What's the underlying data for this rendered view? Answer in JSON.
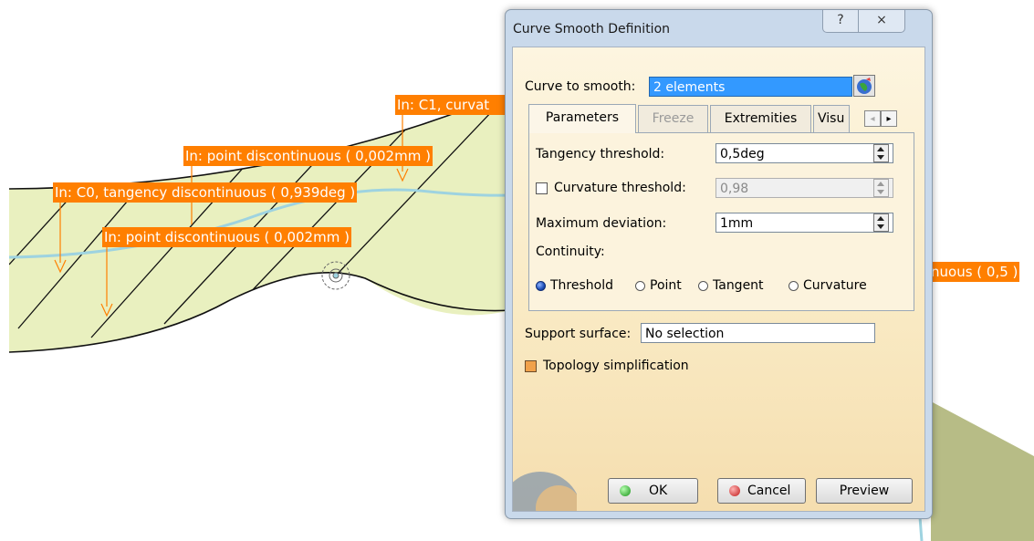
{
  "viewport": {
    "annotations": [
      "In: C1, curvat",
      "In: point discontinuous ( 0,002mm )",
      "In: C0, tangency discontinuous ( 0,939deg )",
      "In: point discontinuous ( 0,002mm )",
      "nuous ( 0,5 )"
    ],
    "colors": {
      "surface": "#e9f0bf",
      "annotation": "#ff7f00",
      "curve": "#9ed3e0"
    }
  },
  "dialog": {
    "title": "Curve Smooth Definition",
    "help_icon": "?",
    "close_icon": "×",
    "curve_to_smooth": {
      "label": "Curve to smooth:",
      "value": "2 elements"
    },
    "tabs": [
      {
        "label": "Parameters",
        "active": true
      },
      {
        "label": "Freeze",
        "disabled": true
      },
      {
        "label": "Extremities"
      },
      {
        "label": "Visu"
      }
    ],
    "tab_arrows": {
      "left": "◂",
      "right": "▸"
    },
    "parameters": {
      "tangency": {
        "label": "Tangency threshold:",
        "value": "0,5deg"
      },
      "curvature": {
        "label": "Curvature threshold:",
        "value": "0,98",
        "checked": false
      },
      "deviation": {
        "label": "Maximum deviation:",
        "value": "1mm"
      },
      "continuity": {
        "label": "Continuity:",
        "options": [
          "Threshold",
          "Point",
          "Tangent",
          "Curvature"
        ],
        "selected": "Threshold"
      }
    },
    "support_surface": {
      "label": "Support surface:",
      "value": "No selection"
    },
    "topology": {
      "label": "Topology simplification",
      "checked": true
    },
    "buttons": {
      "ok": "OK",
      "cancel": "Cancel",
      "preview": "Preview"
    }
  }
}
